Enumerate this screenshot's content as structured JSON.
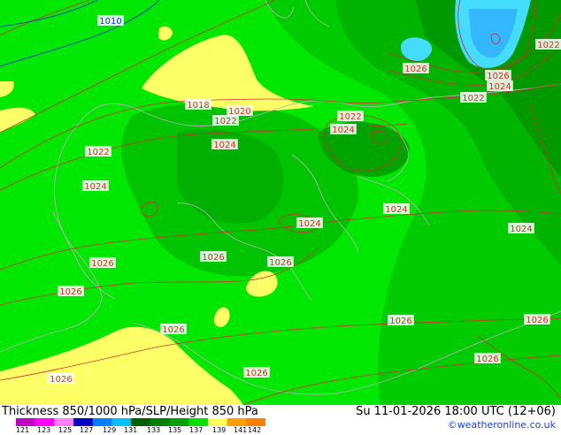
{
  "map": {
    "isobar_labels": [
      {
        "text": "1010",
        "color": "blue"
      },
      {
        "text": "1018",
        "color": "red"
      },
      {
        "text": "1020",
        "color": "red"
      },
      {
        "text": "1022",
        "color": "red"
      },
      {
        "text": "1022",
        "color": "red"
      },
      {
        "text": "1022",
        "color": "red"
      },
      {
        "text": "1022",
        "color": "red"
      },
      {
        "text": "1022",
        "color": "red"
      },
      {
        "text": "1024",
        "color": "red"
      },
      {
        "text": "1024",
        "color": "red"
      },
      {
        "text": "1024",
        "color": "red"
      },
      {
        "text": "1024",
        "color": "red"
      },
      {
        "text": "1024",
        "color": "red"
      },
      {
        "text": "1024",
        "color": "red"
      },
      {
        "text": "1024",
        "color": "red"
      },
      {
        "text": "1026",
        "color": "red"
      },
      {
        "text": "1026",
        "color": "red"
      },
      {
        "text": "1026",
        "color": "red"
      },
      {
        "text": "1026",
        "color": "red"
      },
      {
        "text": "1026",
        "color": "red"
      },
      {
        "text": "1026",
        "color": "red"
      },
      {
        "text": "1026",
        "color": "red"
      },
      {
        "text": "1026",
        "color": "red"
      },
      {
        "text": "1026",
        "color": "red"
      },
      {
        "text": "1026",
        "color": "red"
      },
      {
        "text": "1026",
        "color": "red"
      },
      {
        "text": "1026",
        "color": "red"
      }
    ]
  },
  "footer": {
    "title": "Thickness 850/1000 hPa/SLP/Height 850 hPa",
    "valid_time": "Su 11-01-2026 18:00 UTC (12+06)",
    "credit": "©weatheronline.co.uk"
  },
  "legend": {
    "ticks": [
      "121",
      "123",
      "125",
      "127",
      "129",
      "131",
      "133",
      "135",
      "137",
      "139",
      "141",
      "142"
    ],
    "colors": [
      "#c000c0",
      "#ff00ff",
      "#ff80ff",
      "#0000c0",
      "#0080ff",
      "#00c0ff",
      "#006000",
      "#008000",
      "#00a000",
      "#00e000",
      "#ffff60",
      "#ffa000",
      "#ff8000"
    ]
  },
  "colors": {
    "green_light": "#00ee00",
    "green_mid": "#00c800",
    "green_dark": "#00a000",
    "green_darker": "#008c00",
    "yellow": "#ffff66",
    "cyan": "#44ddff",
    "isobar_red": "#d03030",
    "isobar_blue": "#2030d0",
    "coast": "#b0b0b0"
  }
}
